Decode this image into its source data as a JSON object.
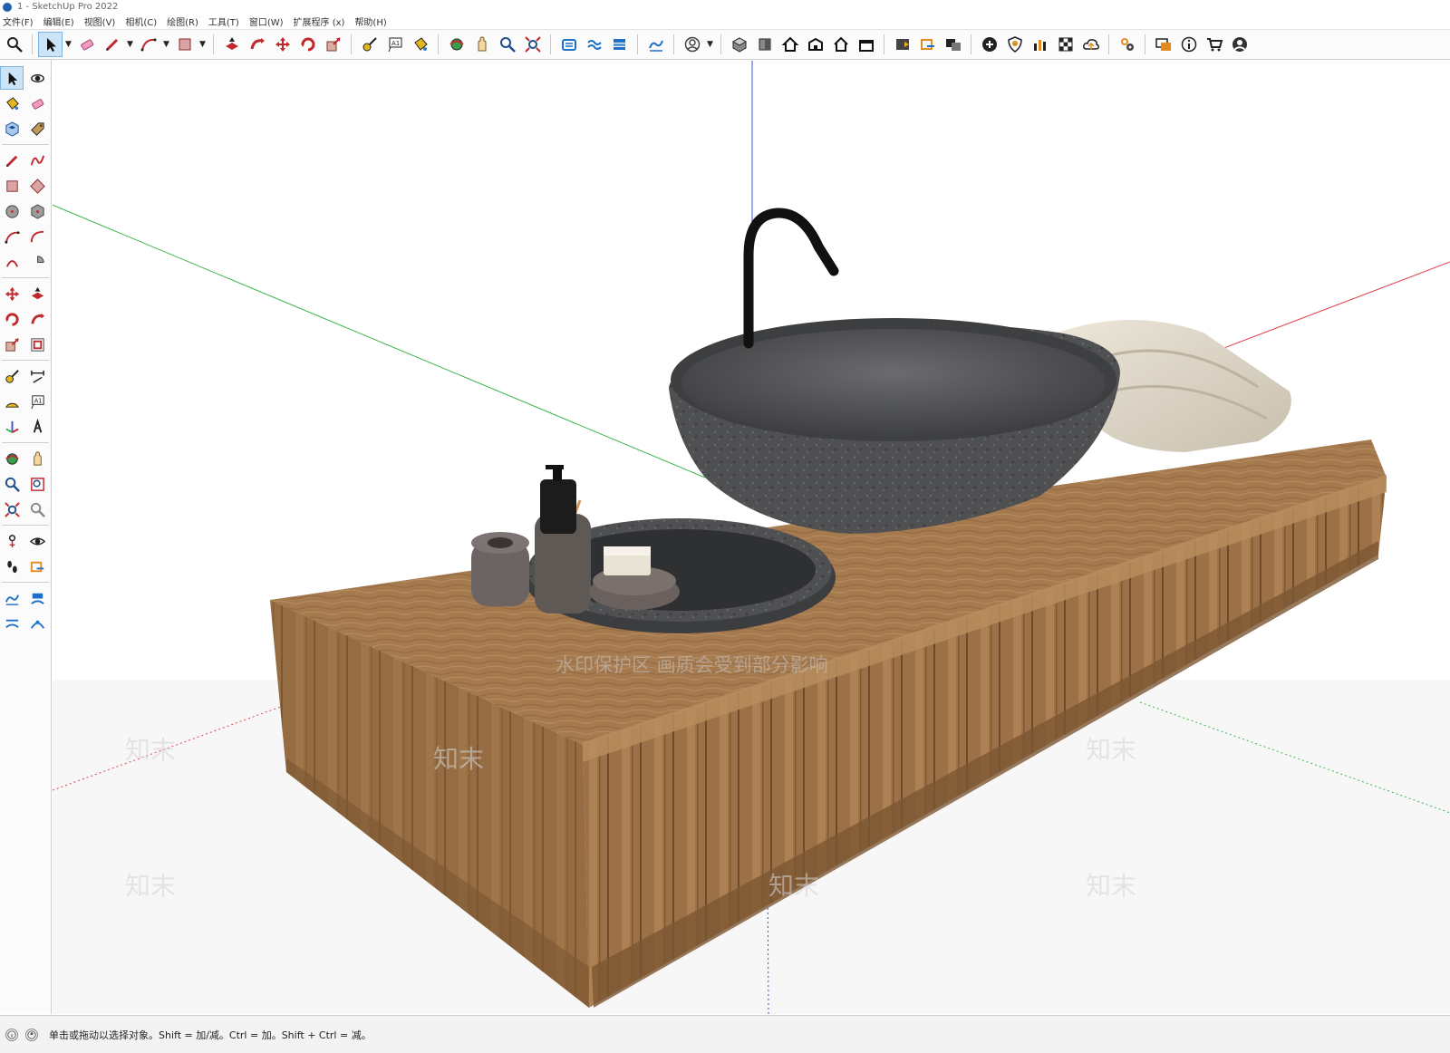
{
  "window": {
    "title": "1 - SketchUp Pro 2022"
  },
  "menu": [
    "文件(F)",
    "编辑(E)",
    "视图(V)",
    "相机(C)",
    "绘图(R)",
    "工具(T)",
    "窗口(W)",
    "扩展程序 (x)",
    "帮助(H)"
  ],
  "toolbar": {
    "groups": [
      [
        "search-icon"
      ],
      [
        "select-arrow-icon",
        "dropdown-caret",
        "eraser-icon",
        "pencil-line-icon",
        "dropdown-caret",
        "arc-icon",
        "dropdown-caret",
        "rectangle-icon",
        "dropdown-caret"
      ],
      [
        "push-pull-icon",
        "follow-me-icon",
        "move-icon",
        "rotate-icon",
        "scale-icon"
      ],
      [
        "tape-measure-icon",
        "text-label-icon",
        "paint-bucket-icon"
      ],
      [
        "orbit-icon",
        "pan-icon",
        "zoom-icon",
        "zoom-extents-icon"
      ],
      [
        "warehouse-icon",
        "extension-icon",
        "layout-icon"
      ],
      [
        "sandbox-icon"
      ],
      [
        "user-account-icon",
        "dropdown-caret"
      ],
      [
        "iso-view-icon",
        "front-view-icon",
        "home-icon",
        "top-view-icon",
        "house-outline-icon",
        "box-view-icon"
      ],
      [
        "style-icon",
        "section-plane-icon",
        "scene-icon"
      ],
      [
        "add-location-icon",
        "shield-icon",
        "bar-chart-icon",
        "checker-icon",
        "cloud-upload-icon"
      ],
      [
        "gear-settings-icon"
      ],
      [
        "message-icon",
        "info-icon",
        "cart-icon",
        "profile-icon"
      ]
    ]
  },
  "left_toolbar": {
    "sections": [
      [
        [
          "select-arrow-icon",
          "orbit-3d-icon"
        ],
        [
          "paint-bucket-icon",
          "eraser-icon"
        ],
        [
          "component-icon",
          "tag-icon"
        ]
      ],
      [
        [
          "pencil-line-icon",
          "freehand-icon"
        ],
        [
          "rectangle-icon",
          "rotated-rectangle-icon"
        ],
        [
          "circle-icon",
          "polygon-icon"
        ],
        [
          "arc-icon",
          "two-point-arc-icon"
        ],
        [
          "three-point-arc-icon",
          "pie-icon"
        ]
      ],
      [
        [
          "move-icon",
          "push-pull-icon"
        ],
        [
          "rotate-icon",
          "follow-me-icon"
        ],
        [
          "scale-icon",
          "offset-icon"
        ]
      ],
      [
        [
          "tape-measure-icon",
          "dimension-icon"
        ],
        [
          "protractor-icon",
          "text-label-icon"
        ],
        [
          "axes-icon",
          "3d-text-icon"
        ]
      ],
      [
        [
          "orbit-icon",
          "pan-icon"
        ],
        [
          "zoom-icon",
          "zoom-window-icon"
        ],
        [
          "zoom-extents-icon",
          "previous-view-icon"
        ]
      ],
      [
        [
          "position-camera-icon",
          "look-around-icon"
        ],
        [
          "walk-icon",
          "section-plane-icon"
        ]
      ],
      [
        [
          "sandbox-icon",
          "sandbox-stamp-icon"
        ],
        [
          "sandbox-drape-icon",
          "sandbox-smoove-icon"
        ]
      ]
    ]
  },
  "viewport": {
    "watermark_text": "水印保护区   画质会受到部分影响",
    "watermark_logo": "知末",
    "axis_colors": {
      "red": "#e0424f",
      "green": "#3bb54a",
      "blue": "#3b4fd8"
    },
    "material_colors": {
      "wood": "#a67a4f",
      "stone": "#4f5052",
      "towel": "#ddd6c8",
      "faucet": "#111111"
    }
  },
  "status": {
    "icons": [
      "info-circle-icon",
      "user-circle-icon"
    ],
    "text": "单击或拖动以选择对象。Shift = 加/减。Ctrl = 加。Shift + Ctrl = 减。"
  }
}
